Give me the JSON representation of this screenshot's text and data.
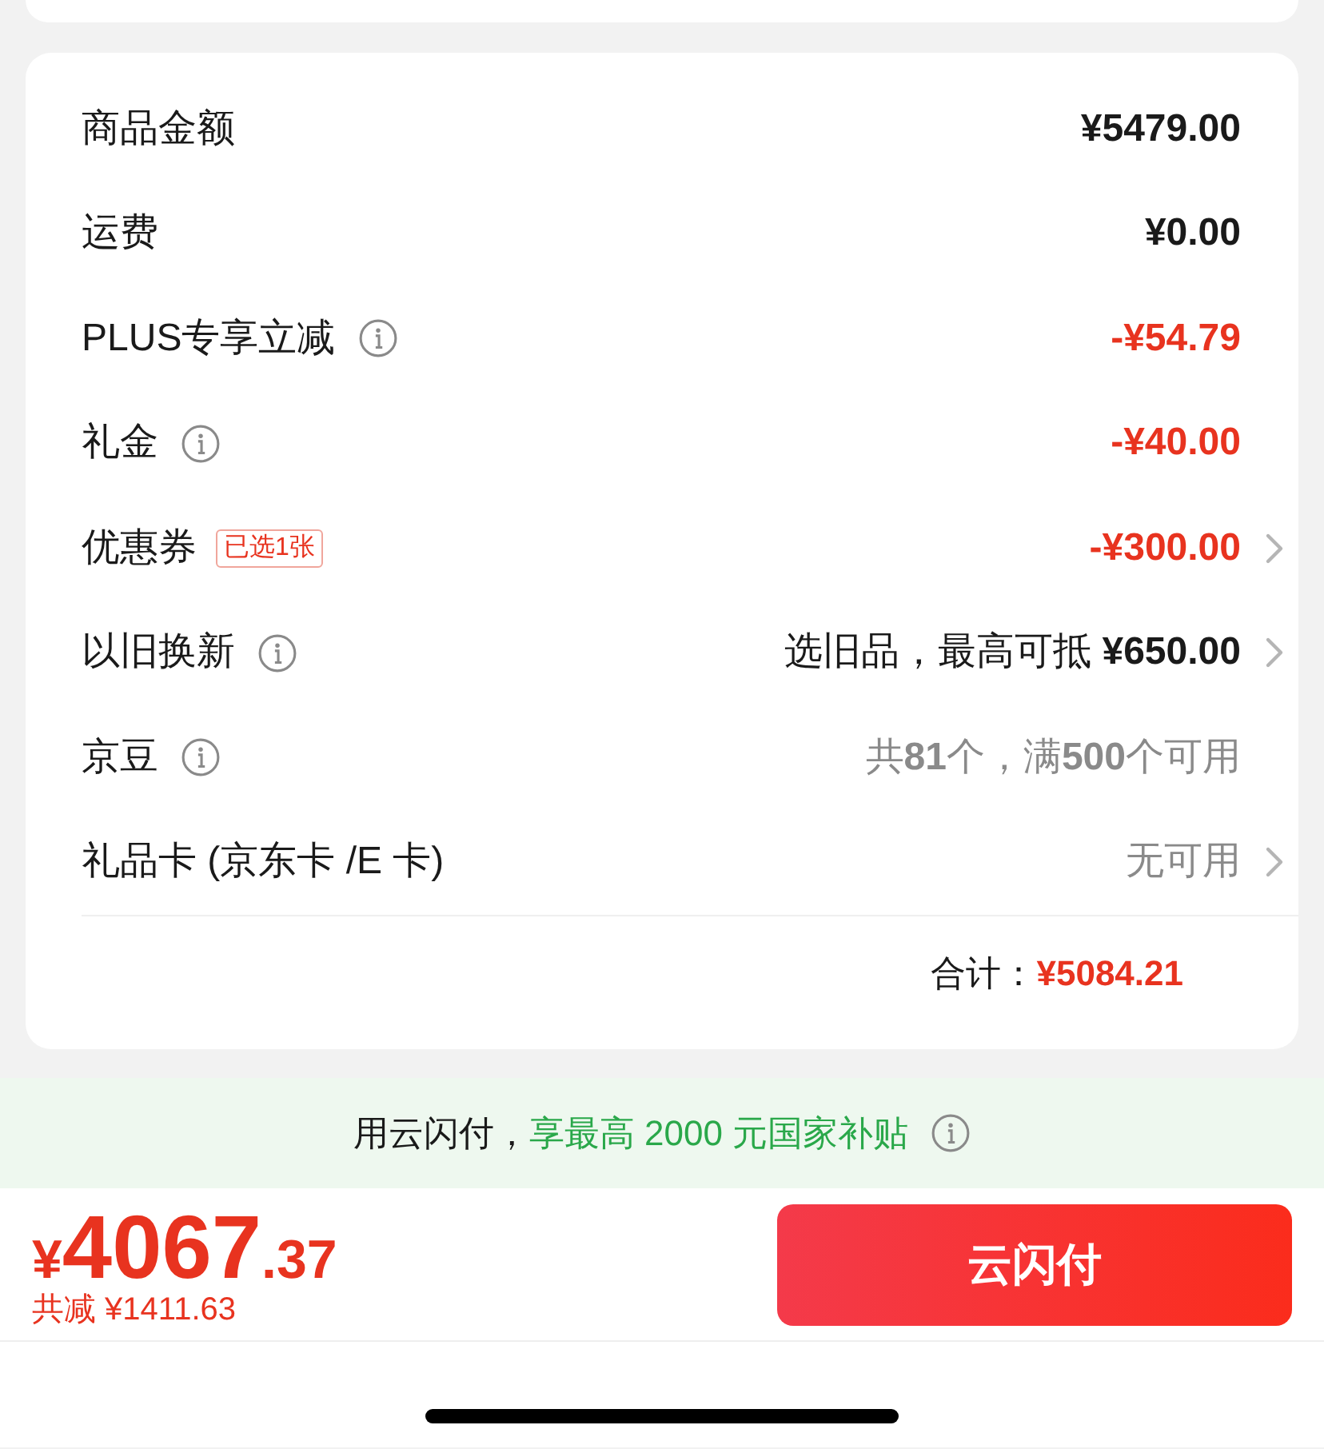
{
  "rows": [
    {
      "label": "商品金额",
      "info_icon": false,
      "kind": "amount",
      "value": "¥5479.00",
      "color": "#1a1a1a",
      "chevron": false
    },
    {
      "label": "运费",
      "info_icon": false,
      "kind": "amount",
      "value": "¥0.00",
      "color": "#1a1a1a",
      "chevron": false
    },
    {
      "label": "PLUS专享立减",
      "info_icon": true,
      "kind": "amount",
      "value": "-¥54.79",
      "color": "#e8331f",
      "chevron": false
    },
    {
      "label": "礼金",
      "info_icon": true,
      "kind": "amount",
      "value": "-¥40.00",
      "color": "#e8331f",
      "chevron": false
    },
    {
      "label": "优惠券",
      "info_icon": false,
      "badge": "已选1张",
      "kind": "amount",
      "value": "-¥300.00",
      "color": "#e8331f",
      "chevron": true
    },
    {
      "label": "以旧换新",
      "info_icon": true,
      "kind": "note",
      "value": "选旧品，最高可抵 **¥650.00**",
      "color": "#1a1a1a",
      "chevron": true
    },
    {
      "label": "京豆",
      "info_icon": true,
      "kind": "note",
      "value": "共**81**个，满**500**个可用",
      "color": "#8a8a8a",
      "chevron": false
    },
    {
      "label": "礼品卡 (京东卡 /E 卡)",
      "info_icon": false,
      "kind": "note",
      "value": "无可用",
      "color": "#8a8a8a",
      "chevron": true
    }
  ],
  "total": {
    "label": "合计：",
    "value": "¥5084.21"
  },
  "banner": {
    "text": "用云闪付，",
    "highlight": "享最高 2000 元国家补贴",
    "info_icon": true
  },
  "footer": {
    "currency": "¥",
    "integer": "4067",
    "decimal": ".37",
    "savings": "共减 ¥1411.63",
    "button": "云闪付"
  }
}
